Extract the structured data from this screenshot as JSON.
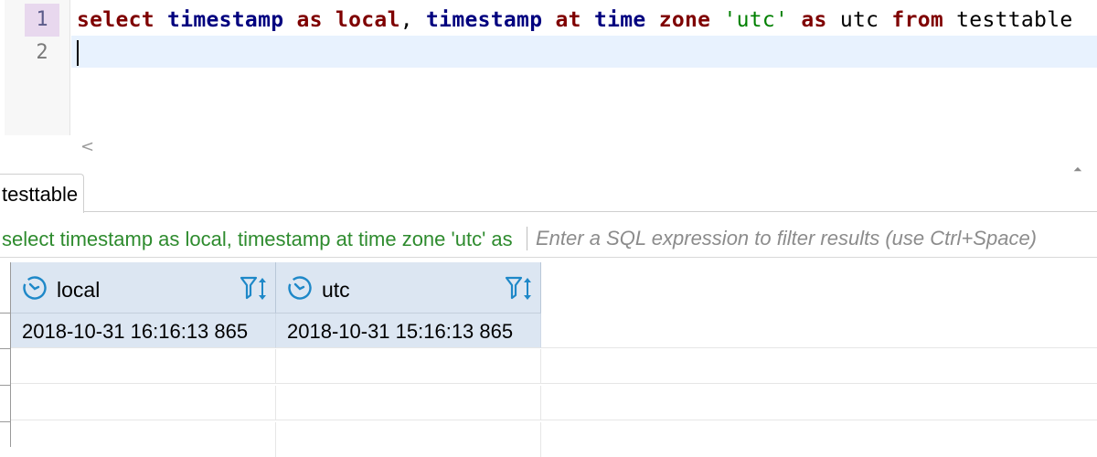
{
  "editor": {
    "line_numbers": [
      "1",
      "2"
    ],
    "line1": {
      "t1": "select",
      "t2": " ",
      "t3": "timestamp",
      "t4": " ",
      "t5": "as",
      "t6": " ",
      "t7": "local",
      "t8": ", ",
      "t9": "timestamp",
      "t10": " ",
      "t11": "at",
      "t12": " ",
      "t13": "time",
      "t14": " ",
      "t15": "zone",
      "t16": " ",
      "t17": "'utc'",
      "t18": " ",
      "t19": "as",
      "t20": " utc ",
      "t21": "from",
      "t22": " testtable"
    },
    "scroll_left_glyph": "<",
    "maximize_glyph": "⏶"
  },
  "results": {
    "tab_label": "testtable",
    "query_text": "select timestamp as local, timestamp at time zone 'utc' as utc from testtable",
    "filter_placeholder": "Enter a SQL expression to filter results (use Ctrl+Space)",
    "columns": [
      {
        "label": "local",
        "icon": "clock-icon"
      },
      {
        "label": "utc",
        "icon": "clock-icon"
      }
    ],
    "rows": [
      [
        "2018-10-31 16:16:13 865",
        "2018-10-31 15:16:13 865"
      ]
    ]
  },
  "colors": {
    "keyword_red": "#7f0000",
    "keyword_blue": "#00007f",
    "string_green": "#008000",
    "header_bg": "#dce6f2",
    "query_green": "#2e8b2e",
    "icon_blue": "#1e88c8"
  }
}
